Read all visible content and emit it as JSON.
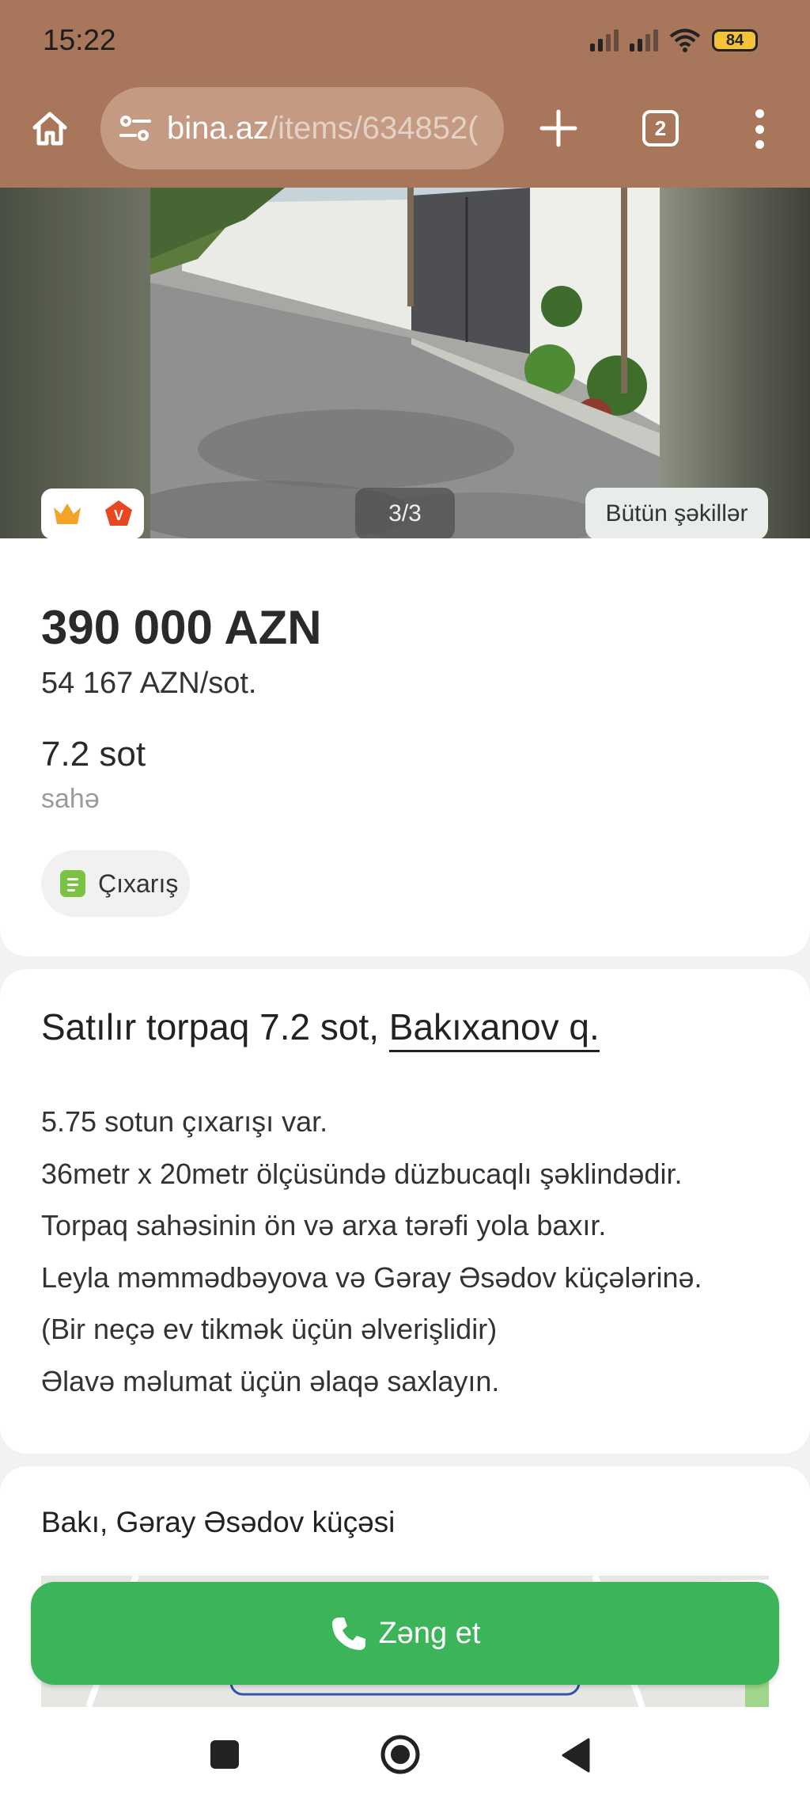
{
  "status_bar": {
    "time": "15:22",
    "battery": "84"
  },
  "browser": {
    "url_domain": "bina.az",
    "url_path": "/items/634852(",
    "tab_count": "2"
  },
  "gallery": {
    "counter": "3/3",
    "all_photos_label": "Bütün şəkillər"
  },
  "listing": {
    "price": "390 000 AZN",
    "price_per_sot": "54 167 AZN/sot.",
    "area_value": "7.2 sot",
    "area_label": "sahə",
    "document_label": "Çıxarış",
    "title_prefix": "Satılır torpaq 7.2 sot,",
    "title_location": "Bakıxanov q.",
    "description": [
      "5.75 sotun çıxarışı var.",
      "36metr x 20metr ölçüsündə düzbucaqlı şəklindədir.",
      "Torpaq sahəsinin ön və arxa tərəfi yola baxır.",
      "Leyla məmmədbəyova və Gəray Əsədov küçələrinə.",
      "(Bir neçə ev tikmək üçün əlverişlidir)",
      "Əlavə məlumat üçün əlaqə saxlayın."
    ],
    "address": "Bakı, Gəray Əsədov küçəsi"
  },
  "actions": {
    "call_label": "Zəng et"
  },
  "colors": {
    "header": "#a8765a",
    "call_button": "#3cb55a",
    "doc_icon": "#7cc242"
  },
  "icons": [
    "home-icon",
    "site-settings-icon",
    "plus-icon",
    "tab-switcher-icon",
    "more-menu-icon",
    "crown-icon",
    "vip-badge-icon",
    "document-icon",
    "phone-icon",
    "recent-apps-icon",
    "home-nav-icon",
    "back-nav-icon"
  ]
}
